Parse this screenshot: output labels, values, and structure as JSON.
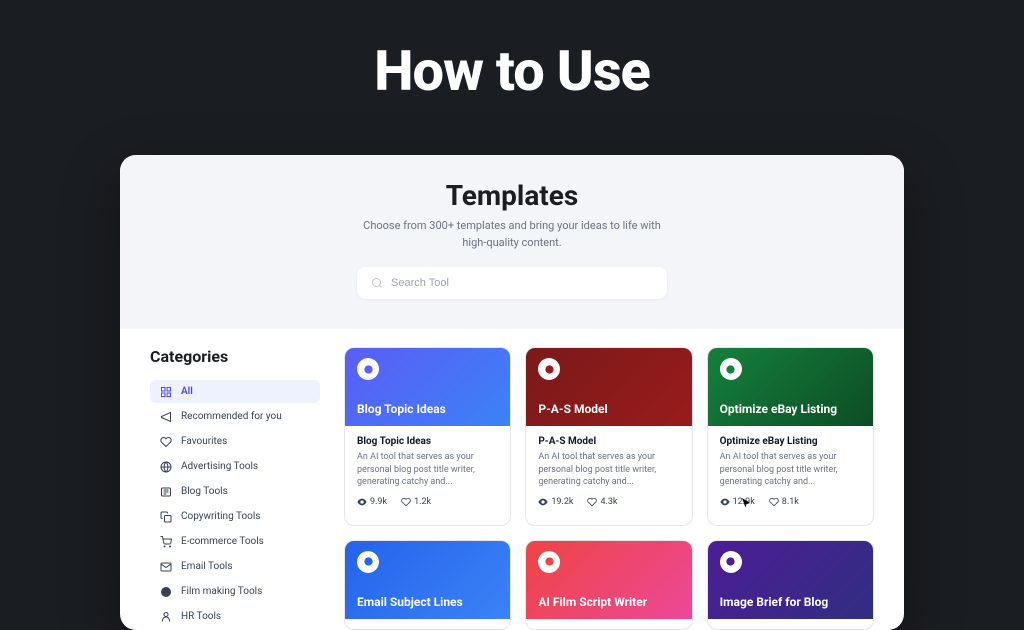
{
  "hero": {
    "title": "How to Use"
  },
  "header": {
    "title": "Templates",
    "subtitle": "Choose from 300+ templates and bring your ideas to life with high-quality content."
  },
  "search": {
    "placeholder": "Search Tool"
  },
  "sidebar": {
    "heading": "Categories",
    "items": [
      {
        "label": "All",
        "icon": "grid",
        "active": true
      },
      {
        "label": "Recommended for you",
        "icon": "megaphone",
        "active": false
      },
      {
        "label": "Favourites",
        "icon": "heart",
        "active": false
      },
      {
        "label": "Advertising Tools",
        "icon": "globe",
        "active": false
      },
      {
        "label": "Blog Tools",
        "icon": "blog",
        "active": false
      },
      {
        "label": "Copywriting Tools",
        "icon": "copy",
        "active": false
      },
      {
        "label": "E-commerce Tools",
        "icon": "cart",
        "active": false
      },
      {
        "label": "Email Tools",
        "icon": "mail",
        "active": false
      },
      {
        "label": "Film making Tools",
        "icon": "film",
        "active": false
      },
      {
        "label": "HR Tools",
        "icon": "hr",
        "active": false
      }
    ]
  },
  "cards": [
    {
      "headTitle": "Blog Topic Ideas",
      "title": "Blog Topic Ideas",
      "desc": "An AI tool that serves as your personal blog post title writer, generating catchy and...",
      "views": "9.9k",
      "likes": "1.2k",
      "gradient": "g-blue",
      "iconColor": "#5b5df6"
    },
    {
      "headTitle": "P-A-S Model",
      "title": "P-A-S Model",
      "desc": "An AI tool that serves as your personal blog post title writer, generating catchy and...",
      "views": "19.2k",
      "likes": "4.3k",
      "gradient": "g-red",
      "iconColor": "#991b1b"
    },
    {
      "headTitle": "Optimize eBay Listing",
      "title": "Optimize eBay Listing",
      "desc": "An AI tool that serves as your personal blog post title writer, generating catchy and...",
      "views": "12.9k",
      "likes": "8.1k",
      "gradient": "g-green",
      "iconColor": "#15803d"
    },
    {
      "headTitle": "Email Subject Lines",
      "title": "Email Subject Lines",
      "desc": "",
      "views": "",
      "likes": "",
      "gradient": "g-blue2",
      "iconColor": "#2563eb"
    },
    {
      "headTitle": "AI Film Script Writer",
      "title": "AI Film Script Writer",
      "desc": "",
      "views": "",
      "likes": "",
      "gradient": "g-pink",
      "iconColor": "#ef4444"
    },
    {
      "headTitle": "Image Brief for Blog",
      "title": "Image Brief for Blog",
      "desc": "",
      "views": "",
      "likes": "",
      "gradient": "g-purple",
      "iconColor": "#4c1d95"
    }
  ]
}
